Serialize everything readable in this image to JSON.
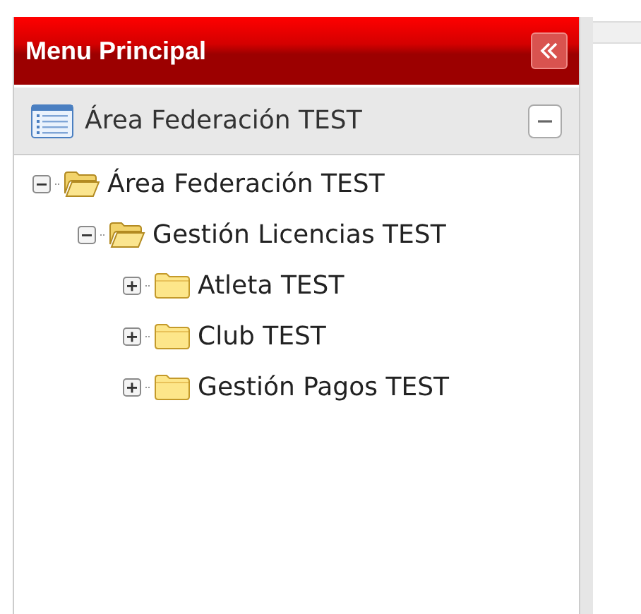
{
  "panel": {
    "title": "Menu Principal"
  },
  "section": {
    "title": "Área Federación TEST",
    "expanded": true
  },
  "tree": [
    {
      "label": "Área Federación TEST",
      "expanded": true,
      "children": [
        {
          "label": "Gestión Licencias TEST",
          "expanded": true,
          "children": [
            {
              "label": "Atleta TEST",
              "expanded": false
            },
            {
              "label": "Club TEST",
              "expanded": false
            },
            {
              "label": "Gestión Pagos TEST",
              "expanded": false
            }
          ]
        }
      ]
    }
  ]
}
